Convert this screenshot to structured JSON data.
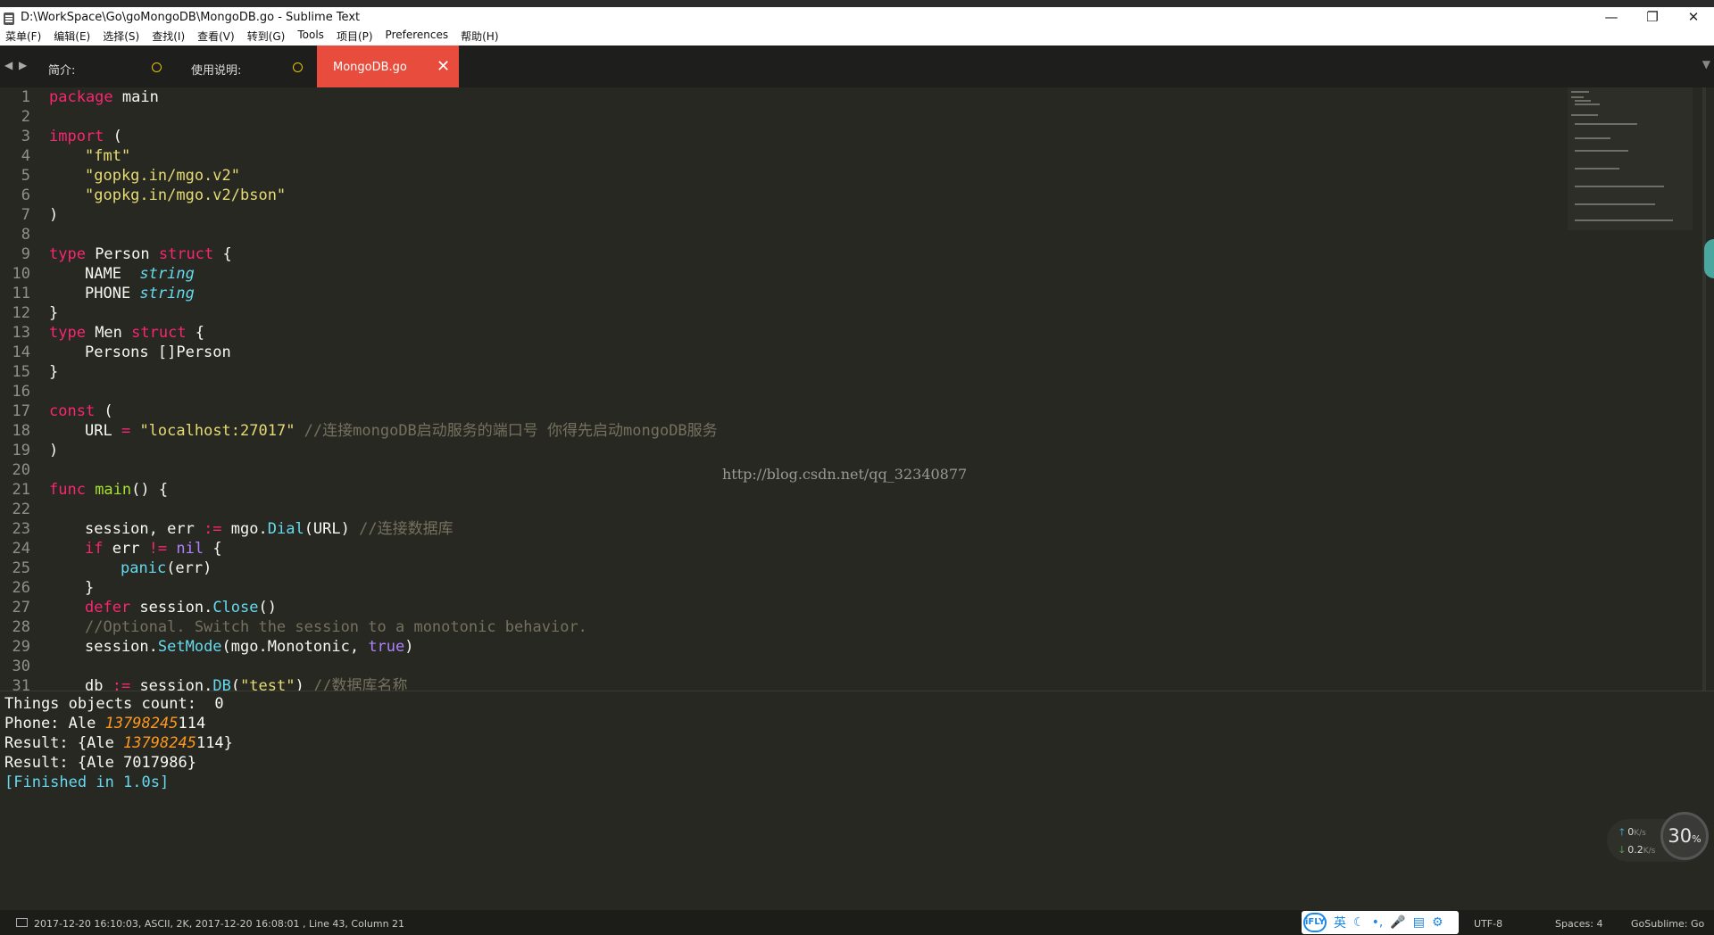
{
  "window": {
    "title": "D:\\WorkSpace\\Go\\goMongoDB\\MongoDB.go - Sublime Text",
    "minimize": "—",
    "maximize": "❐",
    "close": "✕"
  },
  "menu": [
    {
      "label": "菜单(F)"
    },
    {
      "label": "编辑(E)"
    },
    {
      "label": "选择(S)"
    },
    {
      "label": "查找(I)"
    },
    {
      "label": "查看(V)"
    },
    {
      "label": "转到(G)"
    },
    {
      "label": "Tools"
    },
    {
      "label": "项目(P)"
    },
    {
      "label": "Preferences"
    },
    {
      "label": "帮助(H)"
    }
  ],
  "tabs": {
    "nav_prev": "◀",
    "nav_next": "▶",
    "items": [
      {
        "label": "简介:"
      },
      {
        "label": "使用说明:"
      },
      {
        "label": "MongoDB.go"
      }
    ],
    "close_glyph": "✕",
    "overflow": "▼"
  },
  "editor": {
    "lines": [
      {
        "n": "1"
      },
      {
        "n": "2"
      },
      {
        "n": "3"
      },
      {
        "n": "4"
      },
      {
        "n": "5"
      },
      {
        "n": "6"
      },
      {
        "n": "7"
      },
      {
        "n": "8"
      },
      {
        "n": "9"
      },
      {
        "n": "10"
      },
      {
        "n": "11"
      },
      {
        "n": "12"
      },
      {
        "n": "13"
      },
      {
        "n": "14"
      },
      {
        "n": "15"
      },
      {
        "n": "16"
      },
      {
        "n": "17"
      },
      {
        "n": "18"
      },
      {
        "n": "19"
      },
      {
        "n": "20"
      },
      {
        "n": "21"
      },
      {
        "n": "22"
      },
      {
        "n": "23"
      },
      {
        "n": "24"
      },
      {
        "n": "25"
      },
      {
        "n": "26"
      },
      {
        "n": "27"
      },
      {
        "n": "28"
      },
      {
        "n": "29"
      },
      {
        "n": "30"
      },
      {
        "n": "31"
      }
    ],
    "code": {
      "l1_kw": "package",
      "l1_rest": " main",
      "l3_kw": "import",
      "l3_rest": " (",
      "l4": "\"fmt\"",
      "l5": "\"gopkg.in/mgo.v2\"",
      "l6": "\"gopkg.in/mgo.v2/bson\"",
      "l7": ")",
      "l9_kw": "type",
      "l9_name": " Person ",
      "l9_kw2": "struct",
      "l9_rest": " {",
      "l10_field": "NAME  ",
      "l10_type": "string",
      "l11_field": "PHONE ",
      "l11_type": "string",
      "l12": "}",
      "l13_kw": "type",
      "l13_name": " Men ",
      "l13_kw2": "struct",
      "l13_rest": " {",
      "l14": "Persons []Person",
      "l15": "}",
      "l17_kw": "const",
      "l17_rest": " (",
      "l18_name": "URL ",
      "l18_op": "=",
      "l18_str": " \"localhost:27017\"",
      "l18_cm": " //连接mongoDB启动服务的端口号 你得先启动mongoDB服务",
      "l19": ")",
      "l21_kw": "func",
      "l21_fn": " main",
      "l21_rest": "() {",
      "l23_a": "session, err ",
      "l23_op": ":=",
      "l23_b": " mgo.",
      "l23_fn": "Dial",
      "l23_c": "(URL) ",
      "l23_cm": "//连接数据库",
      "l24_kw": "if",
      "l24_a": " err ",
      "l24_op": "!=",
      "l24_b": " ",
      "l24_nil": "nil",
      "l24_c": " {",
      "l25_fn": "panic",
      "l25_rest": "(err)",
      "l26": "}",
      "l27_kw": "defer",
      "l27_a": " session.",
      "l27_fn": "Close",
      "l27_rest": "()",
      "l28_cm": "//Optional. Switch the session to a monotonic behavior.",
      "l29_a": "session.",
      "l29_fn": "SetMode",
      "l29_b": "(mgo.Monotonic, ",
      "l29_true": "true",
      "l29_c": ")",
      "l31_a": "db ",
      "l31_op": ":=",
      "l31_b": " session.",
      "l31_fn": "DB",
      "l31_c": "(",
      "l31_str": "\"test\"",
      "l31_d": ") ",
      "l31_cm": "//数据库名称"
    },
    "watermark": "http://blog.csdn.net/qq_32340877"
  },
  "output": {
    "l1": "Things objects count:  0",
    "l2_a": "Phone: Ale ",
    "l2_num": "13798245",
    "l2_b": "114",
    "l3_a": "Result: {Ale ",
    "l3_num": "13798245",
    "l3_b": "114}",
    "l4": "Result: {Ale 7017986}",
    "l5": "[Finished in 1.0s]"
  },
  "network": {
    "up_arrow": "🡑",
    "up_value": "0",
    "up_unit": "K/s",
    "down_arrow": "🡓",
    "down_value": "0.2",
    "down_unit": "K/s",
    "cpu": "30",
    "cpu_unit": "%"
  },
  "statusbar": {
    "info": "2017-12-20 16:10:03, ASCII, 2K, 2017-12-20 16:08:01 , Line 43, Column 21",
    "ime_logo": "iFLY",
    "ime_items": [
      "英",
      "☾",
      "•,",
      "🎤",
      "▤",
      "⚙"
    ],
    "encoding": "UTF-8",
    "indent": "Spaces: 4",
    "syntax": "GoSublime: Go"
  }
}
